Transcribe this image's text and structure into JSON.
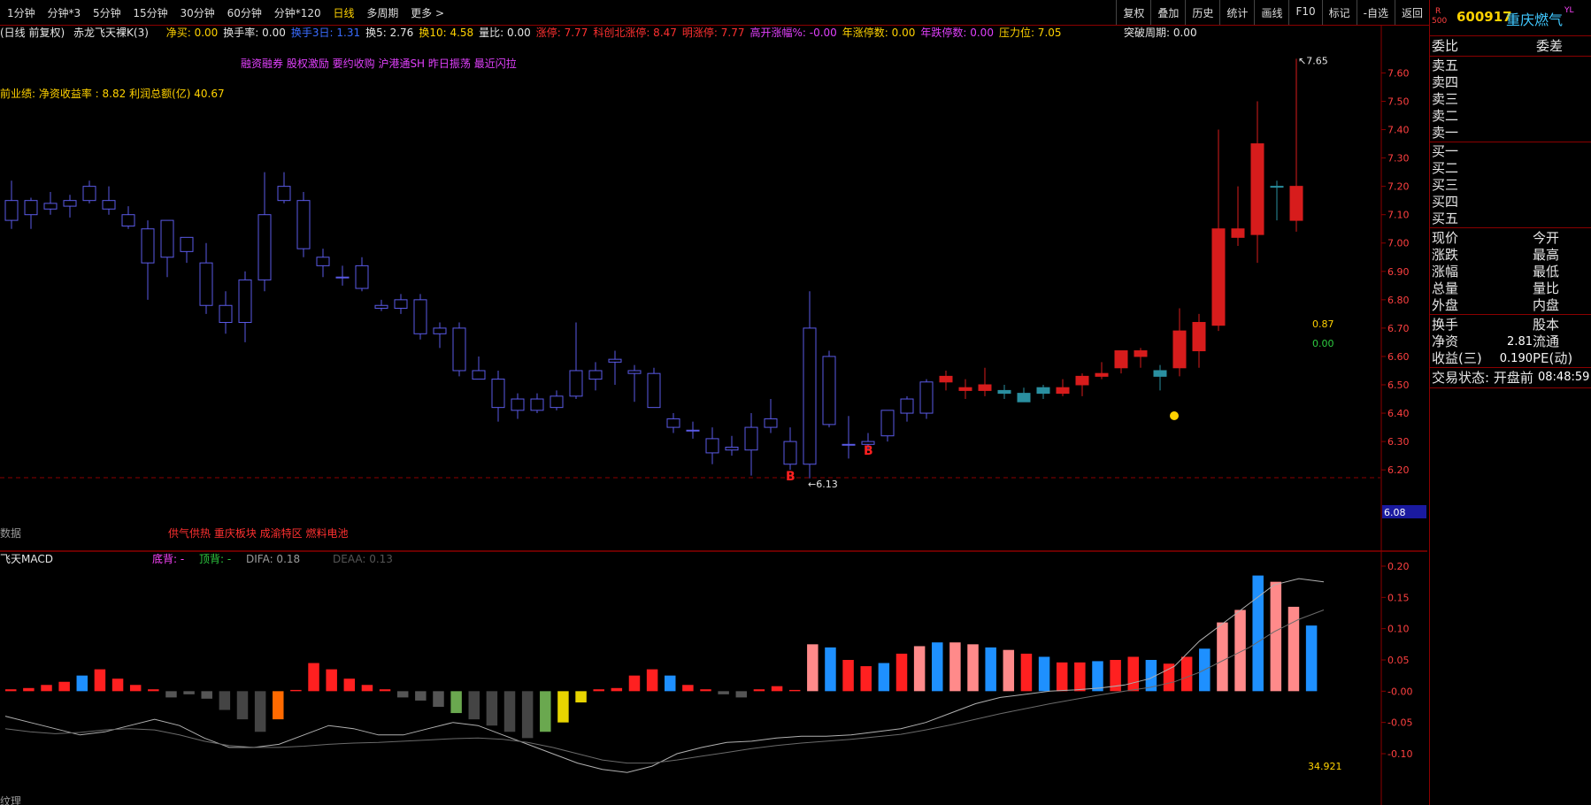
{
  "toolbar": {
    "periods": [
      "1分钟",
      "分钟*3",
      "5分钟",
      "15分钟",
      "30分钟",
      "60分钟",
      "分钟*120",
      "日线",
      "多周期",
      "更多 >"
    ],
    "active_period": "日线",
    "buttons": [
      "复权",
      "叠加",
      "历史",
      "统计",
      "画线",
      "F10",
      "标记",
      "-自选",
      "返回"
    ]
  },
  "info_bar": {
    "chart_mode": "(日线 前复权)",
    "indicator_name": "赤龙飞天裸K(3)",
    "items": [
      {
        "text": "净买: 0.00",
        "color": "#ffd200"
      },
      {
        "text": "换手率: 0.00",
        "color": "#e6e6e6"
      },
      {
        "text": "换手3日: 1.31",
        "color": "#3a6cff"
      },
      {
        "text": "换5: 2.76",
        "color": "#e6e6e6"
      },
      {
        "text": "换10: 4.58",
        "color": "#ffd200"
      },
      {
        "text": "量比: 0.00",
        "color": "#e6e6e6"
      },
      {
        "text": "涨停: 7.77",
        "color": "#ff3030"
      },
      {
        "text": "科创北涨停: 8.47",
        "color": "#ff3030"
      },
      {
        "text": "明涨停: 7.77",
        "color": "#ff3030"
      },
      {
        "text": "高开涨幅%: -0.00",
        "color": "#e040fb"
      },
      {
        "text": "年涨停数: 0.00",
        "color": "#ffd200"
      },
      {
        "text": "年跌停数: 0.00",
        "color": "#e040fb"
      },
      {
        "text": "压力位: 7.05",
        "color": "#ffd200"
      }
    ],
    "breakout": "突破周期: 0.00",
    "tags_line": "融资融券 股权激励 要约收购 沪港通SH 昨日振荡 最近闪拉",
    "performance_line": "前业绩: 净资收益率 : 8.82 利润总额(亿) 40.67",
    "sector_line": "供气供热 重庆板块 成渝特区 燃料电池",
    "data_label": "数据",
    "bottom_label": "纹理"
  },
  "quote_panel": {
    "stock_code": "600917",
    "stock_name": "重庆燃气",
    "badge_r": "R",
    "badge_500": "500",
    "badge_yl": "YL",
    "header_left": "委比",
    "header_right": "委差",
    "sells": [
      "卖五",
      "卖四",
      "卖三",
      "卖二",
      "卖一"
    ],
    "buys": [
      "买一",
      "买二",
      "买三",
      "买四",
      "买五"
    ],
    "stats": [
      {
        "left": "现价",
        "right": "今开",
        "value": ""
      },
      {
        "left": "涨跌",
        "right": "最高",
        "value": ""
      },
      {
        "left": "涨幅",
        "right": "最低",
        "value": ""
      },
      {
        "left": "总量",
        "right": "量比",
        "value": ""
      },
      {
        "left": "外盘",
        "right": "内盘",
        "value": ""
      }
    ],
    "stats2": [
      {
        "left": "换手",
        "right": "股本",
        "value": ""
      },
      {
        "left": "净资",
        "right": "流通",
        "value": "2.81"
      },
      {
        "left": "收益(三)",
        "right": "PE(动)",
        "value": "0.190"
      }
    ],
    "trade_status_label": "交易状态: 开盘前",
    "trade_time": "08:48:59"
  },
  "chart_data": [
    {
      "type": "candlestick",
      "title": "",
      "y_axis_ticks": [
        "7.60",
        "7.50",
        "7.40",
        "7.30",
        "7.20",
        "7.10",
        "7.00",
        "6.90",
        "6.80",
        "6.70",
        "6.60",
        "6.50",
        "6.40",
        "6.30",
        "6.20"
      ],
      "ylim": [
        6.11,
        7.67
      ],
      "current_price_label": "6.08",
      "max_label": "7.65",
      "min_label": "6.13",
      "side_values": [
        {
          "text": "0.87",
          "color": "#ffd200"
        },
        {
          "text": "0.00",
          "color": "#2ecc40"
        }
      ],
      "markers": [
        "B",
        "B"
      ],
      "candles": [
        {
          "o": 7.15,
          "h": 7.22,
          "l": 7.05,
          "c": 7.08,
          "color": "blue"
        },
        {
          "o": 7.1,
          "h": 7.16,
          "l": 7.05,
          "c": 7.15,
          "color": "blue"
        },
        {
          "o": 7.12,
          "h": 7.18,
          "l": 7.1,
          "c": 7.14,
          "color": "blue"
        },
        {
          "o": 7.13,
          "h": 7.17,
          "l": 7.09,
          "c": 7.15,
          "color": "blue"
        },
        {
          "o": 7.2,
          "h": 7.22,
          "l": 7.14,
          "c": 7.15,
          "color": "blue"
        },
        {
          "o": 7.15,
          "h": 7.2,
          "l": 7.1,
          "c": 7.12,
          "color": "blue"
        },
        {
          "o": 7.1,
          "h": 7.13,
          "l": 7.05,
          "c": 7.06,
          "color": "blue"
        },
        {
          "o": 7.05,
          "h": 7.08,
          "l": 6.8,
          "c": 6.93,
          "color": "blue"
        },
        {
          "o": 6.95,
          "h": 7.08,
          "l": 6.88,
          "c": 7.08,
          "color": "blue"
        },
        {
          "o": 6.97,
          "h": 7.0,
          "l": 6.93,
          "c": 7.02,
          "color": "blue"
        },
        {
          "o": 6.93,
          "h": 7.0,
          "l": 6.75,
          "c": 6.78,
          "color": "blue"
        },
        {
          "o": 6.78,
          "h": 6.83,
          "l": 6.68,
          "c": 6.72,
          "color": "blue"
        },
        {
          "o": 6.72,
          "h": 6.9,
          "l": 6.65,
          "c": 6.87,
          "color": "blue"
        },
        {
          "o": 6.87,
          "h": 7.25,
          "l": 6.83,
          "c": 7.1,
          "color": "blue"
        },
        {
          "o": 7.2,
          "h": 7.25,
          "l": 7.14,
          "c": 7.15,
          "color": "blue"
        },
        {
          "o": 7.15,
          "h": 7.18,
          "l": 6.95,
          "c": 6.98,
          "color": "blue"
        },
        {
          "o": 6.95,
          "h": 6.98,
          "l": 6.88,
          "c": 6.92,
          "color": "blue"
        },
        {
          "o": 6.88,
          "h": 6.92,
          "l": 6.85,
          "c": 6.88,
          "color": "blue"
        },
        {
          "o": 6.92,
          "h": 6.95,
          "l": 6.83,
          "c": 6.84,
          "color": "blue"
        },
        {
          "o": 6.78,
          "h": 6.8,
          "l": 6.76,
          "c": 6.77,
          "color": "blue"
        },
        {
          "o": 6.77,
          "h": 6.82,
          "l": 6.75,
          "c": 6.8,
          "color": "blue"
        },
        {
          "o": 6.8,
          "h": 6.82,
          "l": 6.66,
          "c": 6.68,
          "color": "blue"
        },
        {
          "o": 6.68,
          "h": 6.72,
          "l": 6.63,
          "c": 6.7,
          "color": "blue"
        },
        {
          "o": 6.7,
          "h": 6.72,
          "l": 6.53,
          "c": 6.55,
          "color": "blue"
        },
        {
          "o": 6.55,
          "h": 6.6,
          "l": 6.52,
          "c": 6.52,
          "color": "blue"
        },
        {
          "o": 6.52,
          "h": 6.55,
          "l": 6.37,
          "c": 6.42,
          "color": "blue"
        },
        {
          "o": 6.45,
          "h": 6.47,
          "l": 6.38,
          "c": 6.41,
          "color": "blue"
        },
        {
          "o": 6.41,
          "h": 6.47,
          "l": 6.4,
          "c": 6.45,
          "color": "blue"
        },
        {
          "o": 6.42,
          "h": 6.48,
          "l": 6.41,
          "c": 6.46,
          "color": "blue"
        },
        {
          "o": 6.46,
          "h": 6.72,
          "l": 6.45,
          "c": 6.55,
          "color": "blue"
        },
        {
          "o": 6.52,
          "h": 6.58,
          "l": 6.48,
          "c": 6.55,
          "color": "blue"
        },
        {
          "o": 6.59,
          "h": 6.62,
          "l": 6.5,
          "c": 6.58,
          "color": "blue"
        },
        {
          "o": 6.55,
          "h": 6.57,
          "l": 6.44,
          "c": 6.54,
          "color": "blue"
        },
        {
          "o": 6.54,
          "h": 6.56,
          "l": 6.42,
          "c": 6.42,
          "color": "blue"
        },
        {
          "o": 6.38,
          "h": 6.4,
          "l": 6.33,
          "c": 6.35,
          "color": "blue"
        },
        {
          "o": 6.34,
          "h": 6.37,
          "l": 6.31,
          "c": 6.34,
          "color": "blue"
        },
        {
          "o": 6.31,
          "h": 6.35,
          "l": 6.22,
          "c": 6.26,
          "color": "blue"
        },
        {
          "o": 6.28,
          "h": 6.32,
          "l": 6.25,
          "c": 6.27,
          "color": "blue"
        },
        {
          "o": 6.35,
          "h": 6.4,
          "l": 6.18,
          "c": 6.27,
          "color": "blue"
        },
        {
          "o": 6.35,
          "h": 6.45,
          "l": 6.33,
          "c": 6.38,
          "color": "blue"
        },
        {
          "o": 6.3,
          "h": 6.35,
          "l": 6.2,
          "c": 6.22,
          "color": "blue"
        },
        {
          "o": 6.22,
          "h": 6.83,
          "l": 6.17,
          "c": 6.7,
          "color": "blue"
        },
        {
          "o": 6.6,
          "h": 6.62,
          "l": 6.35,
          "c": 6.36,
          "color": "blue"
        },
        {
          "o": 6.29,
          "h": 6.39,
          "l": 6.24,
          "c": 6.29,
          "color": "blue"
        },
        {
          "o": 6.29,
          "h": 6.33,
          "l": 6.27,
          "c": 6.3,
          "color": "blue"
        },
        {
          "o": 6.32,
          "h": 6.41,
          "l": 6.3,
          "c": 6.41,
          "color": "blue"
        },
        {
          "o": 6.4,
          "h": 6.46,
          "l": 6.37,
          "c": 6.45,
          "color": "blue"
        },
        {
          "o": 6.4,
          "h": 6.52,
          "l": 6.38,
          "c": 6.51,
          "color": "blue"
        },
        {
          "o": 6.51,
          "h": 6.55,
          "l": 6.48,
          "c": 6.53,
          "color": "red"
        },
        {
          "o": 6.48,
          "h": 6.52,
          "l": 6.45,
          "c": 6.49,
          "color": "red"
        },
        {
          "o": 6.5,
          "h": 6.56,
          "l": 6.46,
          "c": 6.48,
          "color": "red"
        },
        {
          "o": 6.48,
          "h": 6.5,
          "l": 6.45,
          "c": 6.47,
          "color": "teal"
        },
        {
          "o": 6.47,
          "h": 6.49,
          "l": 6.44,
          "c": 6.44,
          "color": "teal"
        },
        {
          "o": 6.47,
          "h": 6.5,
          "l": 6.45,
          "c": 6.49,
          "color": "teal"
        },
        {
          "o": 6.47,
          "h": 6.52,
          "l": 6.46,
          "c": 6.49,
          "color": "red"
        },
        {
          "o": 6.5,
          "h": 6.54,
          "l": 6.46,
          "c": 6.53,
          "color": "red"
        },
        {
          "o": 6.53,
          "h": 6.58,
          "l": 6.52,
          "c": 6.54,
          "color": "red"
        },
        {
          "o": 6.56,
          "h": 6.62,
          "l": 6.54,
          "c": 6.62,
          "color": "red"
        },
        {
          "o": 6.6,
          "h": 6.63,
          "l": 6.56,
          "c": 6.62,
          "color": "red"
        },
        {
          "o": 6.55,
          "h": 6.57,
          "l": 6.48,
          "c": 6.53,
          "color": "teal"
        },
        {
          "o": 6.56,
          "h": 6.77,
          "l": 6.53,
          "c": 6.69,
          "color": "red"
        },
        {
          "o": 6.62,
          "h": 6.75,
          "l": 6.56,
          "c": 6.72,
          "color": "red"
        },
        {
          "o": 6.71,
          "h": 7.4,
          "l": 6.69,
          "c": 7.05,
          "color": "red"
        },
        {
          "o": 7.02,
          "h": 7.2,
          "l": 6.99,
          "c": 7.05,
          "color": "red"
        },
        {
          "o": 7.03,
          "h": 7.5,
          "l": 6.93,
          "c": 7.35,
          "color": "red"
        },
        {
          "o": 7.2,
          "h": 7.22,
          "l": 7.08,
          "c": 7.2,
          "color": "teal"
        },
        {
          "o": 7.08,
          "h": 7.65,
          "l": 7.04,
          "c": 7.2,
          "color": "red"
        }
      ]
    },
    {
      "type": "bar",
      "title": "飞天MACD",
      "legend": [
        {
          "text": "底背: -",
          "color": "#ff44ff"
        },
        {
          "text": "顶背: -",
          "color": "#2ecc40"
        },
        {
          "text": "DIFA: 0.18",
          "color": "#9a9a9a"
        },
        {
          "text": "DEAA: 0.13",
          "color": "#555555"
        }
      ],
      "y_axis_ticks": [
        "0.20",
        "0.15",
        "0.10",
        "0.05",
        "-0.00",
        "-0.05",
        "-0.10"
      ],
      "ylim": [
        -0.175,
        0.2
      ],
      "side_value": "34.921",
      "values": [
        0.003,
        0.005,
        0.01,
        0.015,
        0.025,
        0.035,
        0.02,
        0.01,
        0.003,
        -0.01,
        -0.005,
        -0.012,
        -0.03,
        -0.045,
        -0.065,
        -0.045,
        0.002,
        0.045,
        0.035,
        0.02,
        0.01,
        0.003,
        -0.01,
        -0.015,
        -0.025,
        -0.035,
        -0.045,
        -0.055,
        -0.065,
        -0.075,
        -0.065,
        -0.05,
        -0.018,
        0.003,
        0.005,
        0.025,
        0.035,
        0.025,
        0.01,
        0.003,
        -0.005,
        -0.01,
        0.003,
        0.008,
        0.002,
        0.075,
        0.07,
        0.05,
        0.04,
        0.045,
        0.06,
        0.072,
        0.078,
        0.078,
        0.075,
        0.07,
        0.066,
        0.06,
        0.055,
        0.046,
        0.046,
        0.048,
        0.05,
        0.055,
        0.05,
        0.044,
        0.055,
        0.068,
        0.11,
        0.13,
        0.185,
        0.175,
        0.135,
        0.105
      ],
      "difa": [
        -0.04,
        -0.05,
        -0.06,
        -0.07,
        -0.065,
        -0.055,
        -0.045,
        -0.055,
        -0.075,
        -0.09,
        -0.09,
        -0.085,
        -0.07,
        -0.055,
        -0.06,
        -0.07,
        -0.07,
        -0.06,
        -0.05,
        -0.055,
        -0.07,
        -0.085,
        -0.1,
        -0.115,
        -0.125,
        -0.13,
        -0.12,
        -0.1,
        -0.09,
        -0.082,
        -0.08,
        -0.075,
        -0.072,
        -0.072,
        -0.07,
        -0.065,
        -0.06,
        -0.05,
        -0.035,
        -0.02,
        -0.01,
        -0.005,
        0.0,
        0.002,
        0.005,
        0.01,
        0.02,
        0.04,
        0.08,
        0.11,
        0.14,
        0.17,
        0.18,
        0.175
      ],
      "deaa": [
        -0.06,
        -0.065,
        -0.068,
        -0.066,
        -0.062,
        -0.06,
        -0.062,
        -0.07,
        -0.08,
        -0.087,
        -0.09,
        -0.09,
        -0.088,
        -0.085,
        -0.083,
        -0.082,
        -0.08,
        -0.078,
        -0.076,
        -0.075,
        -0.077,
        -0.082,
        -0.09,
        -0.1,
        -0.11,
        -0.115,
        -0.115,
        -0.11,
        -0.104,
        -0.098,
        -0.092,
        -0.087,
        -0.083,
        -0.08,
        -0.077,
        -0.073,
        -0.069,
        -0.062,
        -0.054,
        -0.045,
        -0.036,
        -0.028,
        -0.02,
        -0.013,
        -0.006,
        0.0,
        0.006,
        0.015,
        0.03,
        0.05,
        0.07,
        0.095,
        0.115,
        0.13
      ]
    }
  ],
  "colors": {
    "up": "#d71c1c",
    "down_blue": "#5a5ae6",
    "teal": "#2a8fa0",
    "grid_red": "#8b0000",
    "axis_text": "#ff4040"
  }
}
